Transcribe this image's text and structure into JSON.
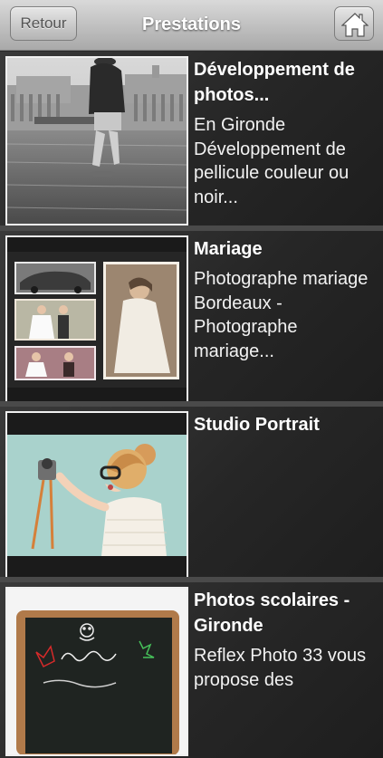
{
  "nav": {
    "back_label": "Retour",
    "title": "Prestations",
    "home_icon": "home-icon"
  },
  "items": [
    {
      "title": "Développement de photos...",
      "description": "En Gironde Développement de pellicule couleur ou noir...",
      "image": "street-photo-child-in-water"
    },
    {
      "title": "Mariage",
      "description": "Photographe mariage Bordeaux - Photographe mariage...",
      "image": "wedding-photo-collage"
    },
    {
      "title": "Studio Portrait",
      "description": "",
      "image": "girl-with-camera-portrait"
    },
    {
      "title": "Photos scolaires - Gironde",
      "description": "Reflex Photo 33 vous propose des",
      "image": "chalkboard-rentree"
    }
  ],
  "colors": {
    "nav_gradient_top": "#d9d9d9",
    "nav_gradient_bottom": "#a9a9a9",
    "row_background": "#2b2b2b",
    "text": "#ffffff"
  }
}
